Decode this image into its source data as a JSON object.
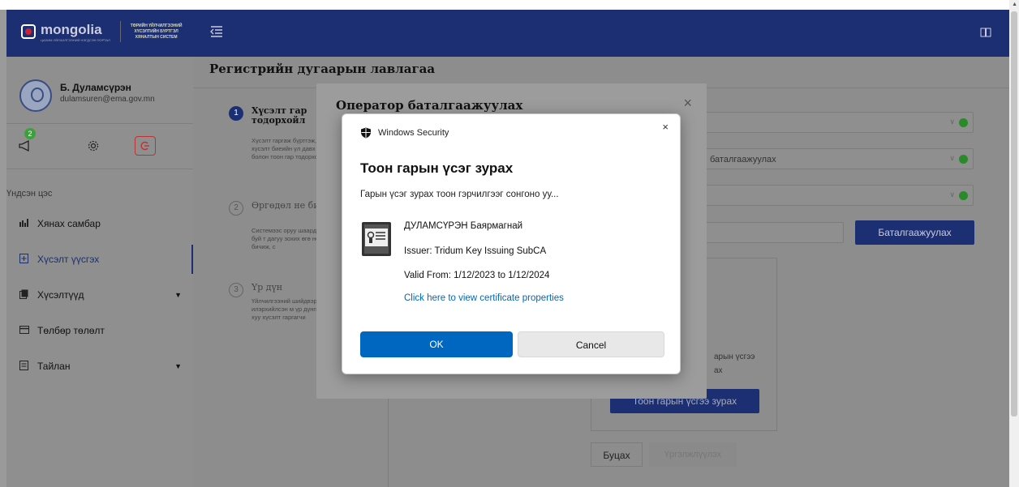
{
  "header": {
    "logo_text": "mongolia",
    "logo_subtitle": "ЦАХИМ УЙЛЧИЛГЭЭНИЙ НЭГДСЭН ПОРТАЛ",
    "system_name_line1": "ТӨРИЙН ҮЙЛЧИЛГЭЭНИЙ",
    "system_name_line2": "ХҮСЭЛТИЙН БҮРТГЭЛ",
    "system_name_line3": "ХЯНАЛТЫН СИСТЕМ"
  },
  "user": {
    "name": "Б. Дуламсүрэн",
    "email": "dulamsuren@ema.gov.mn",
    "notification_count": "2"
  },
  "sidebar": {
    "section_label": "Үндсэн цэс",
    "items": [
      {
        "label": "Хянах самбар",
        "icon": "chart-icon"
      },
      {
        "label": "Хүсэлт үүсгэх",
        "icon": "document-add-icon",
        "active": true
      },
      {
        "label": "Хүсэлтүүд",
        "icon": "copy-icon",
        "has_children": true
      },
      {
        "label": "Төлбөр төлөлт",
        "icon": "card-icon"
      },
      {
        "label": "Тайлан",
        "icon": "report-icon",
        "has_children": true
      }
    ]
  },
  "main": {
    "page_title": "Регистрийн дугаарын лавлагаа",
    "steps": [
      {
        "num": "1",
        "title": "Хүсэлт гар тодорхойл",
        "desc": "Хүсэлт гаргаж бүртгэж, хүсэлт биеийн үл давх болон тоон гар тодорхойлох"
      },
      {
        "num": "2",
        "title": "Өргөдөл не бичих",
        "desc": "Системээс оруу шаардаж буй т дагуу зохих өгө нөхөн бичиж, с"
      },
      {
        "num": "3",
        "title": "Үр дүн",
        "desc": "Үйлчилгээний шийдвэрлэгдс илэрхийлсэн м үр дүнгийн хуу хүсэлт гаргагчи"
      }
    ],
    "field2_value": "баталгаажуулах",
    "confirm_button": "Баталгаажуулах",
    "panel_text_line1": "арын үсгээ",
    "panel_text_line2": "ах",
    "sign_button": "Тоон гарын үсгээ зурах",
    "back_button": "Буцах",
    "next_button": "Үргэлжлүүлэх"
  },
  "operator_modal": {
    "title": "Оператор баталгаажуулах",
    "close": "×"
  },
  "windows_security": {
    "header": "Windows Security",
    "close": "×",
    "title": "Тоон гарын үсэг зурах",
    "subtitle": "Гарын үсэг зурах тоон гэрчилгээг сонгоно уу...",
    "cert_name": "ДУЛАМСҮРЭН Баярмагнай",
    "issuer": "Issuer: Tridum Key Issuing SubCA",
    "valid": "Valid From: 1/12/2023 to 1/12/2024",
    "link": "Click here to view certificate properties",
    "ok": "OK",
    "cancel": "Cancel"
  },
  "colors": {
    "brand": "#1b2f72",
    "windows_blue": "#0067c0",
    "success": "#2a8a2a"
  }
}
